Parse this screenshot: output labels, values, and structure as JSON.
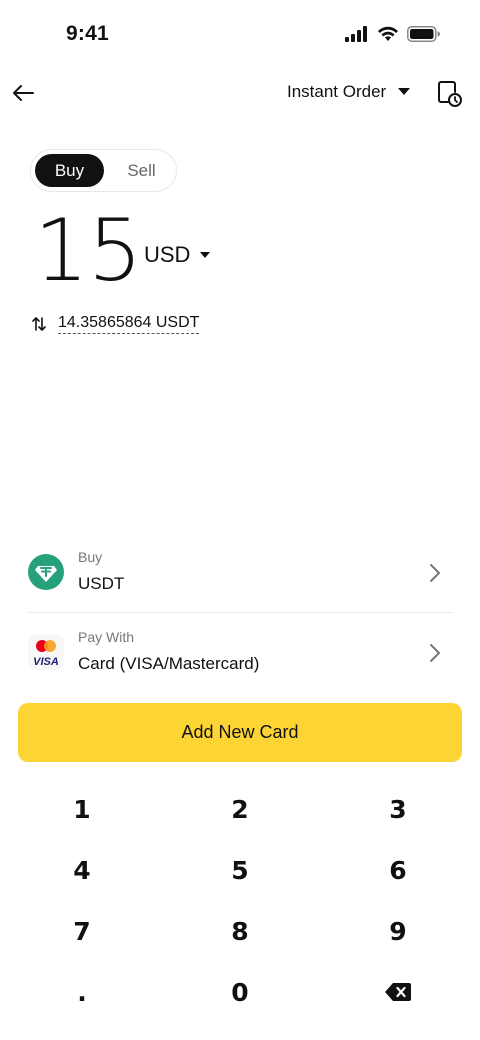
{
  "status_bar": {
    "time": "9:41"
  },
  "nav": {
    "order_type": "Instant Order"
  },
  "toggle": {
    "buy": "Buy",
    "sell": "Sell"
  },
  "amount": {
    "value": "15",
    "currency": "USD"
  },
  "conversion": {
    "value": "14.35865864 USDT"
  },
  "buy_row": {
    "label": "Buy",
    "asset": "USDT"
  },
  "pay_row": {
    "label": "Pay With",
    "method": "Card (VISA/Mastercard)",
    "card_brand": "VISA"
  },
  "cta": {
    "label": "Add New Card"
  },
  "keypad": {
    "keys": [
      "1",
      "2",
      "3",
      "4",
      "5",
      "6",
      "7",
      "8",
      "9",
      "0"
    ],
    "decimal": "."
  },
  "colors": {
    "accent": "#fcd535",
    "tether": "#26a17b",
    "text": "#111111"
  }
}
